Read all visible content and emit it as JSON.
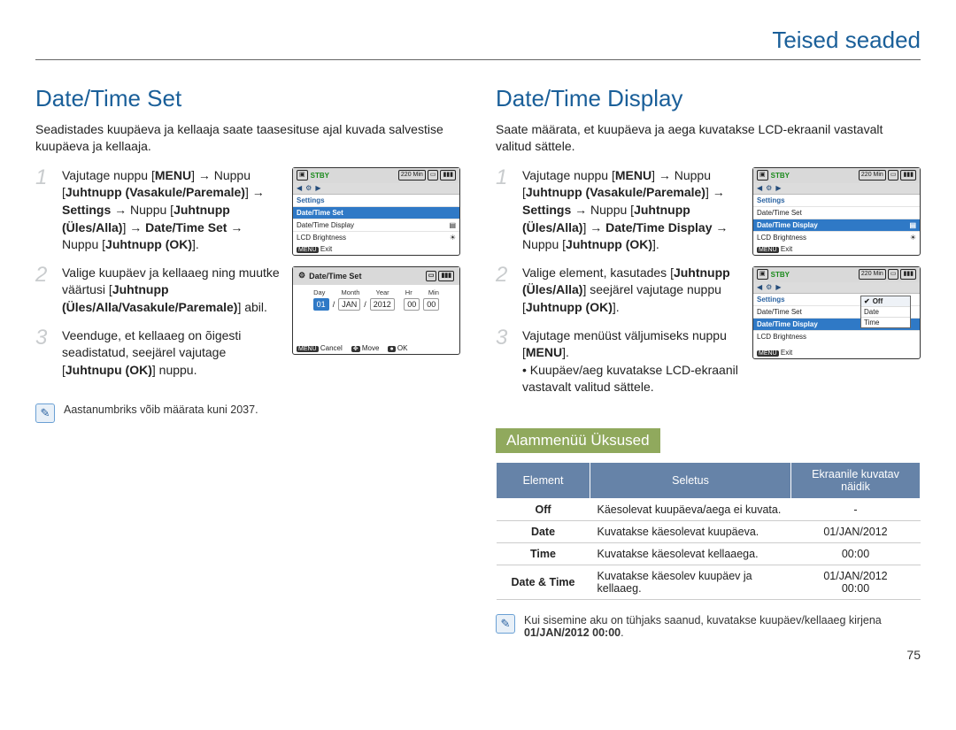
{
  "chapter_title": "Teised seaded",
  "page_number": "75",
  "left": {
    "heading": "Date/Time Set",
    "intro": "Seadistades kuupäeva ja kellaaja saate taasesituse ajal kuvada salvestise kuupäeva ja kellaaja.",
    "steps": {
      "s1": {
        "num": "1",
        "text": "Vajutage nuppu [MENU] → Nuppu [Juhtnupp (Vasakule/Paremale)] → Settings → Nuppu [Juhtnupp (Üles/Alla)] → Date/Time Set → Nuppu [Juhtnupp (OK)]."
      },
      "s2": {
        "num": "2",
        "text": "Valige kuupäev ja kellaaeg ning muutke väärtusi [Juhtnupp (Üles/Alla/Vasakule/Paremale)] abil."
      },
      "s3": {
        "num": "3",
        "text": "Veenduge, et kellaaeg on õigesti seadistatud, seejärel vajutage [Juhtnupu (OK)] nuppu."
      }
    },
    "note": "Aastanumbriks võib määrata kuni 2037.",
    "lcd_menu": {
      "stby": "STBY",
      "min": "220 Min",
      "settings": "Settings",
      "items": [
        "Date/Time Set",
        "Date/Time Display",
        "LCD Brightness"
      ],
      "exit": "Exit",
      "menu_tag": "MENU"
    },
    "lcd_set": {
      "title": "Date/Time Set",
      "labels": [
        "Day",
        "Month",
        "Year",
        "Hr",
        "Min"
      ],
      "values": [
        "01",
        "JAN",
        "2012",
        "00",
        "00"
      ],
      "cancel": "Cancel",
      "move": "Move",
      "ok": "OK",
      "menu_tag": "MENU"
    }
  },
  "right": {
    "heading": "Date/Time Display",
    "intro": "Saate määrata, et kuupäeva ja aega kuvatakse LCD-ekraanil vastavalt valitud sättele.",
    "steps": {
      "s1": {
        "num": "1",
        "text": "Vajutage nuppu [MENU] → Nuppu [Juhtnupp (Vasakule/Paremale)] → Settings → Nuppu [Juhtnupp (Üles/Alla)] → Date/Time Display → Nuppu [Juhtnupp (OK)]."
      },
      "s2": {
        "num": "2",
        "text": "Valige element, kasutades [Juhtnupp (Üles/Alla)] seejärel vajutage nuppu [Juhtnupp (OK)]."
      },
      "s3": {
        "num": "3",
        "text": "Vajutage menüüst väljumiseks nuppu [MENU].",
        "bullet": "Kuupäev/aeg kuvatakse LCD-ekraanil vastavalt valitud sättele."
      }
    },
    "lcd_menu": {
      "stby": "STBY",
      "min": "220 Min",
      "settings": "Settings",
      "items": [
        "Date/Time Set",
        "Date/Time Display",
        "LCD Brightness"
      ],
      "exit": "Exit",
      "menu_tag": "MENU"
    },
    "lcd_dd": {
      "stby": "STBY",
      "min": "220 Min",
      "settings": "Settings",
      "items": [
        "Date/Time Set",
        "Date/Time Display",
        "LCD Brightness"
      ],
      "dropdown": [
        "Off",
        "Date",
        "Time"
      ],
      "exit": "Exit",
      "menu_tag": "MENU"
    },
    "sub_heading": "Alammenüü Üksused",
    "table": {
      "headers": [
        "Element",
        "Seletus",
        "Ekraanile kuvatav näidik"
      ],
      "rows": [
        {
          "el": "Off",
          "desc": "Käesolevat kuupäeva/aega ei kuvata.",
          "disp": "-"
        },
        {
          "el": "Date",
          "desc": "Kuvatakse käesolevat kuupäeva.",
          "disp": "01/JAN/2012"
        },
        {
          "el": "Time",
          "desc": "Kuvatakse käesolevat kellaaega.",
          "disp": "00:00"
        },
        {
          "el": "Date & Time",
          "desc": "Kuvatakse käesolev kuupäev ja kellaaeg.",
          "disp": "01/JAN/2012 00:00"
        }
      ]
    },
    "note": "Kui sisemine aku on tühjaks saanud, kuvatakse kuupäev/kellaaeg kirjena 01/JAN/2012 00:00."
  }
}
